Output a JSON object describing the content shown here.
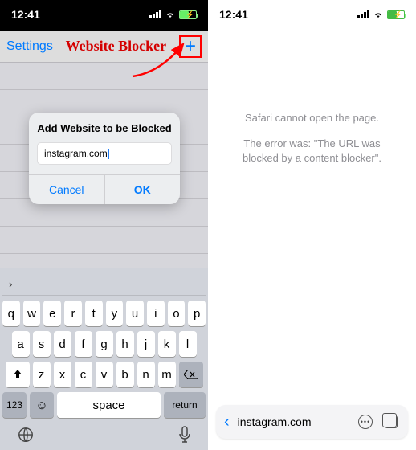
{
  "statusbar": {
    "time": "12:41"
  },
  "left": {
    "nav": {
      "settings": "Settings",
      "annotation": "Website Blocker"
    },
    "alert": {
      "title": "Add Website to be Blocked",
      "input_value": "instagram.com",
      "cancel": "Cancel",
      "ok": "OK"
    },
    "keyboard": {
      "row1": [
        "q",
        "w",
        "e",
        "r",
        "t",
        "y",
        "u",
        "i",
        "o",
        "p"
      ],
      "row2": [
        "a",
        "s",
        "d",
        "f",
        "g",
        "h",
        "j",
        "k",
        "l"
      ],
      "row3": [
        "z",
        "x",
        "c",
        "v",
        "b",
        "n",
        "m"
      ],
      "n123": "123",
      "space": "space",
      "ret": "return"
    }
  },
  "right": {
    "msg1": "Safari cannot open the page.",
    "msg2": "The error was: \"The URL was blocked by a content blocker\".",
    "url": "instagram.com"
  }
}
